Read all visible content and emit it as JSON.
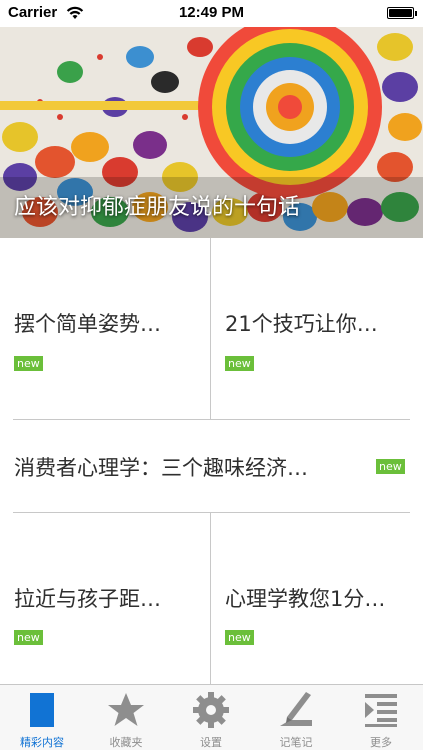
{
  "status_bar": {
    "carrier": "Carrier",
    "time": "12:49 PM"
  },
  "banner": {
    "caption": "应该对抑郁症朋友说的十句话"
  },
  "articles": [
    {
      "title": "摆个简单姿势…",
      "badge": "new"
    },
    {
      "title": "21个技巧让你…",
      "badge": "new"
    },
    {
      "title": "消费者心理学：三个趣味经济…",
      "badge": "new"
    },
    {
      "title": "拉近与孩子距…",
      "badge": "new"
    },
    {
      "title": "心理学教您1分…",
      "badge": "new"
    }
  ],
  "tabbar": {
    "items": [
      {
        "label": "精彩内容",
        "icon": "featured-icon",
        "active": true
      },
      {
        "label": "收藏夹",
        "icon": "star-icon",
        "active": false
      },
      {
        "label": "设置",
        "icon": "gear-icon",
        "active": false
      },
      {
        "label": "记笔记",
        "icon": "pen-icon",
        "active": false
      },
      {
        "label": "更多",
        "icon": "more-list-icon",
        "active": false
      }
    ]
  },
  "colors": {
    "accent": "#1173d4",
    "badge": "#6bbf3a",
    "divider": "#c8c8c8",
    "inactive": "#8e8e8e"
  }
}
